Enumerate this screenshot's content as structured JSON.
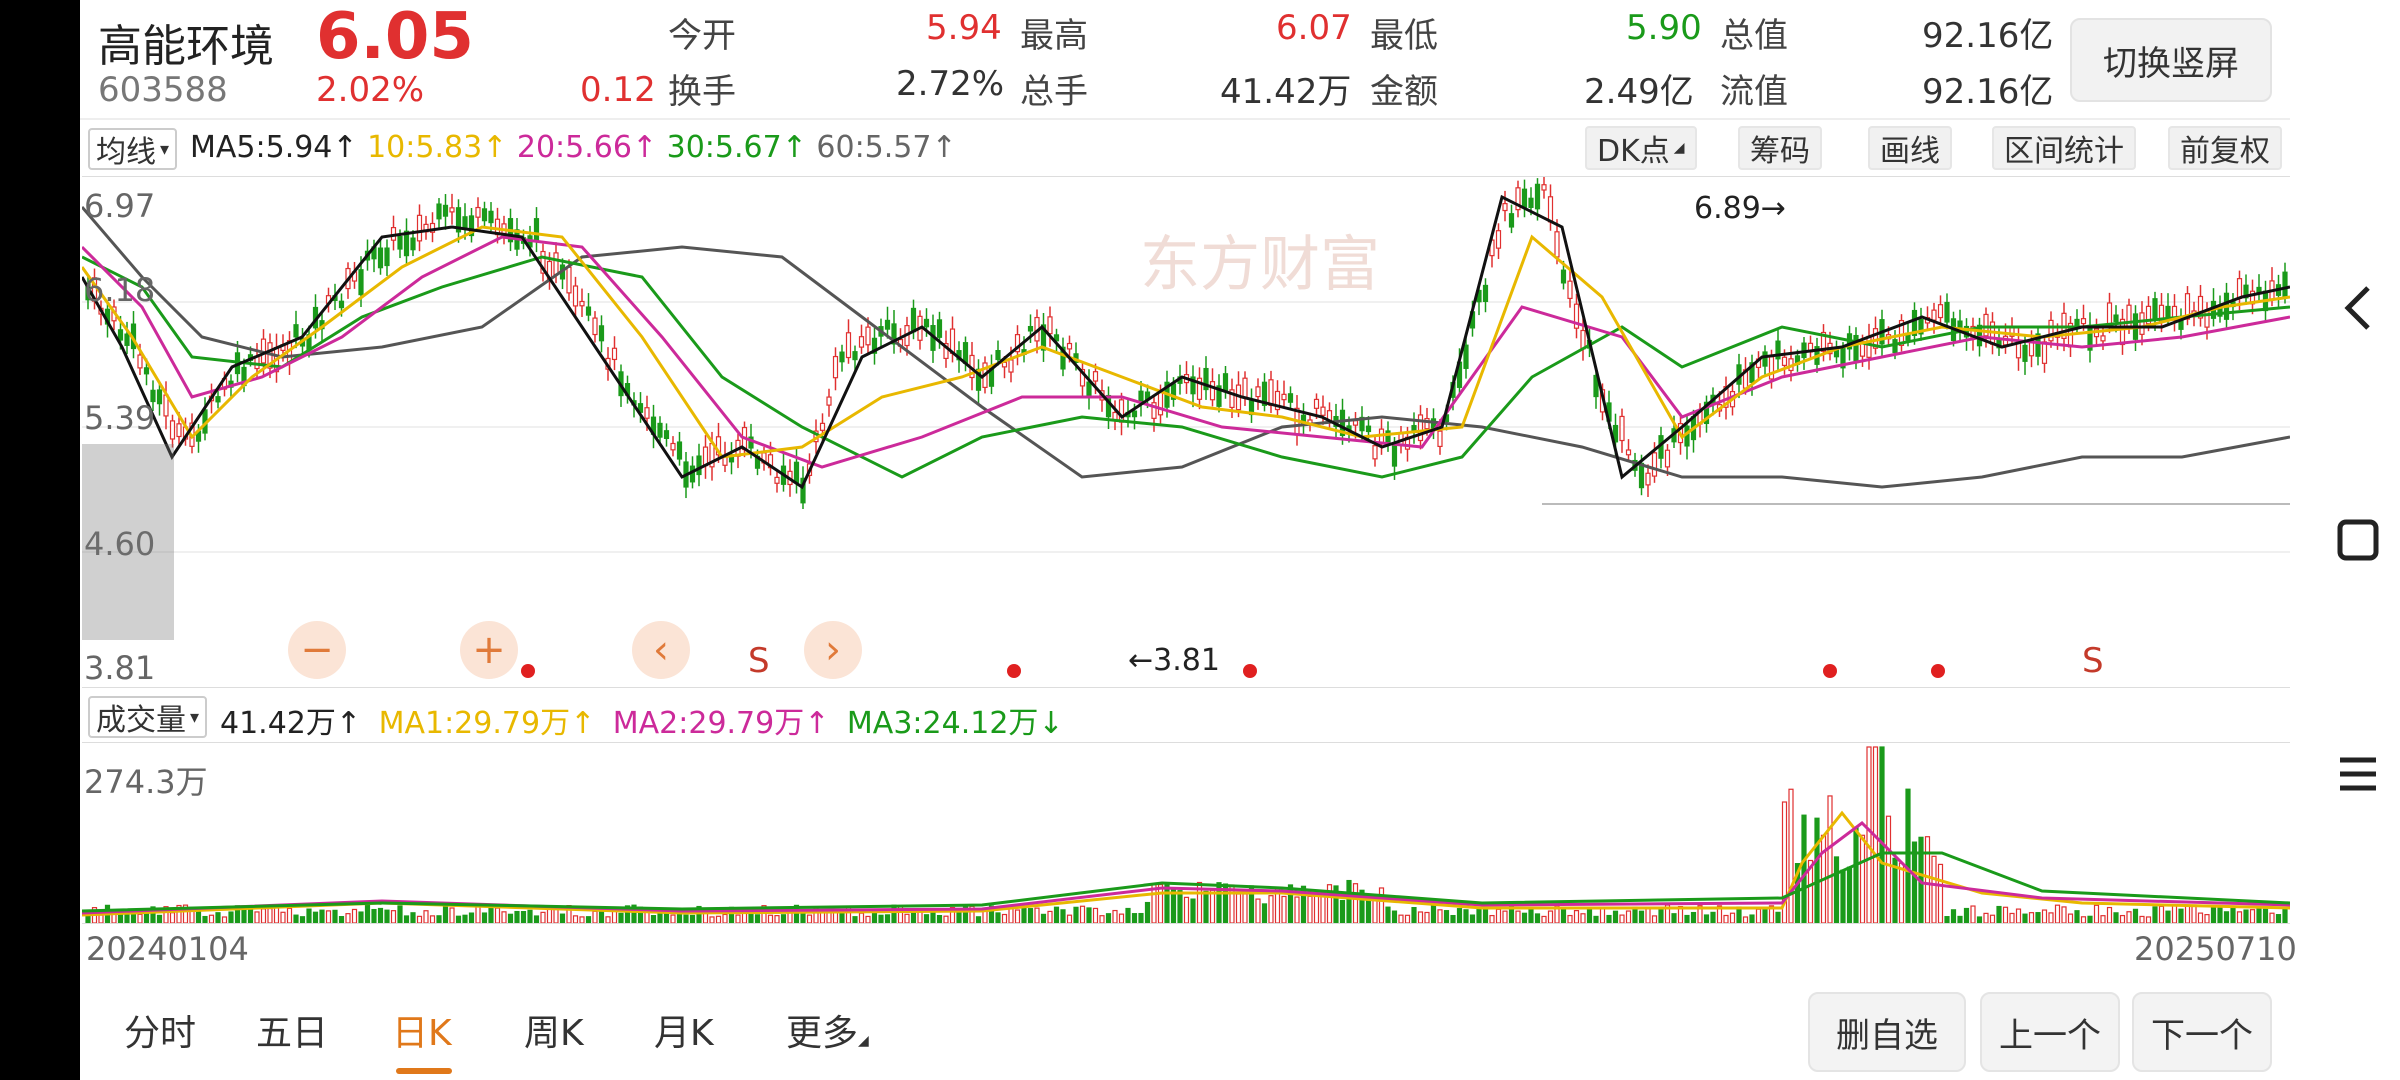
{
  "stock": {
    "name": "高能环境",
    "price": "6.05",
    "code": "603588",
    "change_pct": "2.02%",
    "change": "0.12"
  },
  "stats": [
    {
      "label": "今开",
      "value": "5.94",
      "color": "#e03030"
    },
    {
      "label": "最高",
      "value": "6.07",
      "color": "#e03030"
    },
    {
      "label": "最低",
      "value": "5.90",
      "color": "#1a9a1a"
    },
    {
      "label": "总值",
      "value": "92.16亿",
      "color": "#333333"
    },
    {
      "label": "换手",
      "value": "2.72%",
      "color": "#333333"
    },
    {
      "label": "总手",
      "value": "41.42万",
      "color": "#333333"
    },
    {
      "label": "金额",
      "value": "2.49亿",
      "color": "#333333"
    },
    {
      "label": "流值",
      "value": "92.16亿",
      "color": "#333333"
    }
  ],
  "switch_button": "切换竖屏",
  "indicators": {
    "ma_selector": "均线",
    "ma5": "MA5:5.94",
    "ma10": "10:5.83",
    "ma20": "20:5.66",
    "ma30": "30:5.67",
    "ma60": "60:5.57",
    "arrow_up": "↑",
    "colors": {
      "ma5": "#222222",
      "ma10": "#e8b800",
      "ma20": "#cc2a9a",
      "ma30": "#1a9a1a",
      "ma60": "#666666"
    }
  },
  "tools": [
    "DK点",
    "筹码",
    "画线",
    "区间统计",
    "前复权"
  ],
  "price_axis": [
    "6.97",
    "6.18",
    "5.39",
    "4.60",
    "3.81"
  ],
  "annotations": {
    "high": "6.89",
    "low": "3.81"
  },
  "chart_controls": [
    "−",
    "+",
    "‹",
    "›"
  ],
  "signal_s": "S",
  "volume": {
    "selector": "成交量",
    "value": "41.42万",
    "ma1": "MA1:29.79万",
    "ma2": "MA2:29.79万",
    "ma3": "MA3:24.12万",
    "arrow_up": "↑",
    "arrow_down": "↓",
    "max_label": "274.3万"
  },
  "dates": {
    "start": "20240104",
    "end": "20250710"
  },
  "tabs": [
    {
      "label": "分时",
      "active": false
    },
    {
      "label": "五日",
      "active": false
    },
    {
      "label": "日K",
      "active": true
    },
    {
      "label": "周K",
      "active": false
    },
    {
      "label": "月K",
      "active": false
    },
    {
      "label": "更多",
      "active": false
    }
  ],
  "bottom_buttons": [
    "删自选",
    "上一个",
    "下一个"
  ],
  "watermark": "东方财富"
}
